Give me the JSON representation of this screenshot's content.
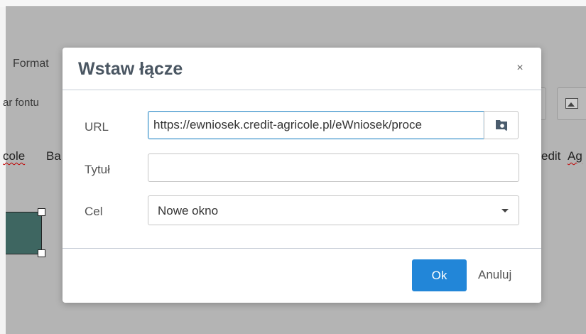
{
  "background": {
    "format_label": "Format",
    "font_size_label": "ar fontu",
    "doc_text_left": "cole",
    "doc_text_left_2": "Ba",
    "doc_text_right": "edit",
    "doc_text_right_2": "Ag"
  },
  "dialog": {
    "title": "Wstaw łącze",
    "close_glyph": "×",
    "fields": {
      "url": {
        "label": "URL",
        "value": "https://ewniosek.credit-agricole.pl/eWniosek/proce"
      },
      "title": {
        "label": "Tytuł",
        "value": ""
      },
      "target": {
        "label": "Cel",
        "selected": "Nowe okno"
      }
    },
    "browse_icon": "browse-icon",
    "ok_label": "Ok",
    "cancel_label": "Anuluj"
  },
  "colors": {
    "accent": "#2286d8",
    "overlay": "#b4b4b4",
    "shape_fill": "#3e6661"
  }
}
